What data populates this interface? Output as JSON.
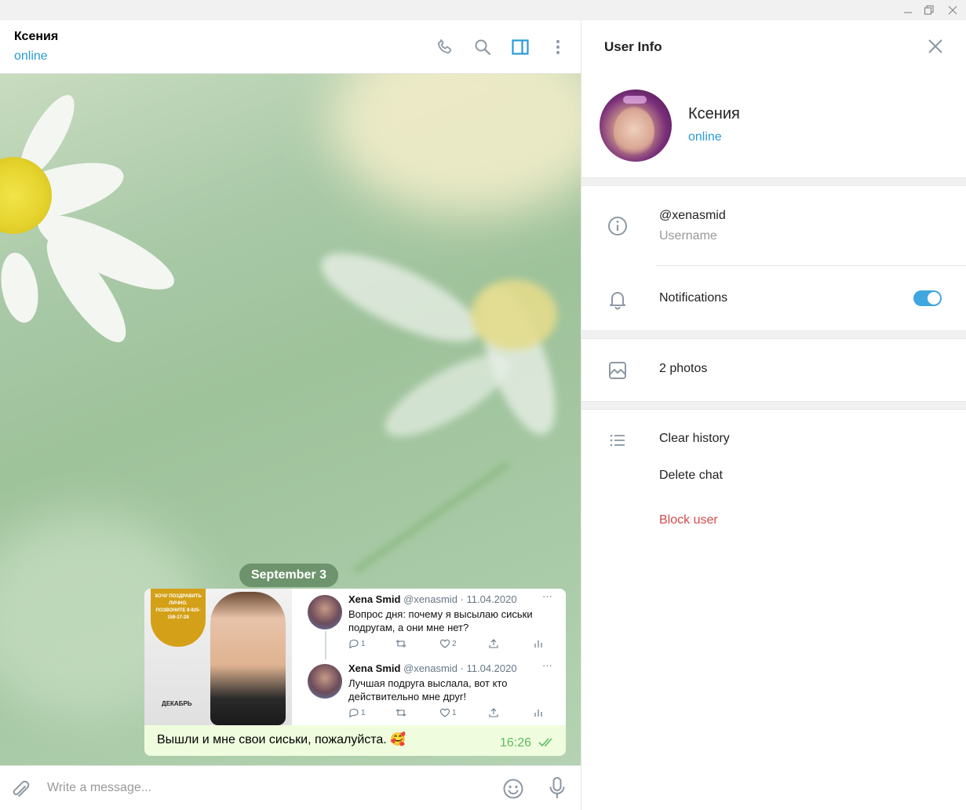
{
  "window": {
    "controls": [
      "minimize-icon",
      "restore-icon",
      "close-icon"
    ]
  },
  "chat": {
    "title": "Ксения",
    "status": "online",
    "header_icons": [
      "phone-icon",
      "search-icon",
      "sidebar-toggle-icon",
      "more-vertical-icon"
    ],
    "date_separator": "September 3",
    "message": {
      "caption": "Вышли и мне свои сиськи, пожалуйста. 🥰",
      "time": "16:26",
      "read_icon": "double-check-icon",
      "photo": {
        "poster_badge_text": "ХОЧУ ПОЗДРАВИТЬ ЛИЧНО. ПОЗВОНИТЕ 8-925-159-17-28",
        "poster_month": "ДЕКАБРЬ",
        "tweets": [
          {
            "name": "Xena Smid",
            "meta": "@xenasmid · 11.04.2020",
            "more": "···",
            "text": "Вопрос дня: почему я высылаю сиськи подругам, а они мне нет?",
            "replies": "1",
            "retweets": "",
            "likes": "2"
          },
          {
            "name": "Xena Smid",
            "meta": "@xenasmid · 11.04.2020",
            "more": "···",
            "text": "Лучшая подруга выслала, вот кто действительно мне друг!",
            "replies": "1",
            "retweets": "",
            "likes": "1"
          }
        ]
      }
    },
    "composer": {
      "placeholder": "Write a message...",
      "attach_icon": "paperclip-icon",
      "emoji_icon": "smile-icon",
      "mic_icon": "microphone-icon"
    }
  },
  "info": {
    "title": "User Info",
    "profile": {
      "name": "Ксения",
      "status": "online"
    },
    "username": {
      "value": "@xenasmid",
      "label": "Username"
    },
    "notifications": {
      "label": "Notifications",
      "enabled": true
    },
    "photos": "2 photos",
    "actions": {
      "clear_history": "Clear history",
      "delete_chat": "Delete chat",
      "block_user": "Block user"
    },
    "colors": {
      "accent": "#2a9bd6",
      "toggle": "#3fa6e0",
      "danger": "#d14b4b",
      "message_bubble": "#effdde",
      "time": "#5fbb5f"
    }
  }
}
